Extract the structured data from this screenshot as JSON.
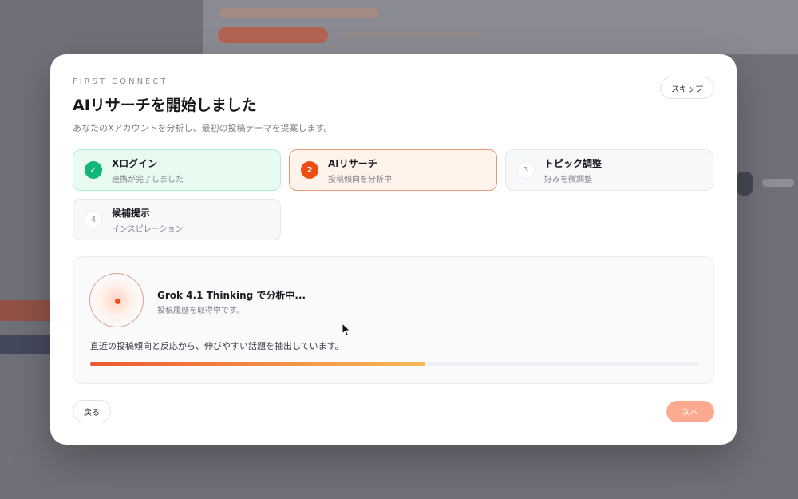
{
  "modal": {
    "eyebrow": "FIRST CONNECT",
    "title": "AIリサーチを開始しました",
    "subtitle": "あなたのXアカウントを分析し、最初の投稿テーマを提案します。",
    "skip_label": "スキップ"
  },
  "steps": [
    {
      "badge": "✓",
      "title": "Xログイン",
      "desc": "連携が完了しました",
      "state": "done"
    },
    {
      "badge": "2",
      "title": "AIリサーチ",
      "desc": "投稿傾向を分析中",
      "state": "active"
    },
    {
      "badge": "3",
      "title": "トピック調整",
      "desc": "好みを微調整",
      "state": "pending"
    },
    {
      "badge": "4",
      "title": "候補提示",
      "desc": "インスピレーション",
      "state": "pending"
    }
  ],
  "analysis": {
    "title": "Grok 4.1 Thinking で分析中...",
    "subtitle": "投稿履歴を取得中です。",
    "description": "直近の投稿傾向と反応から、伸びやすい話題を抽出しています。",
    "progress_percent": 55
  },
  "footer": {
    "back_label": "戻る",
    "next_label": "次へ"
  },
  "colors": {
    "accent": "#ee4d14",
    "success": "#10b77a",
    "next_button": "#fbaa8f"
  }
}
